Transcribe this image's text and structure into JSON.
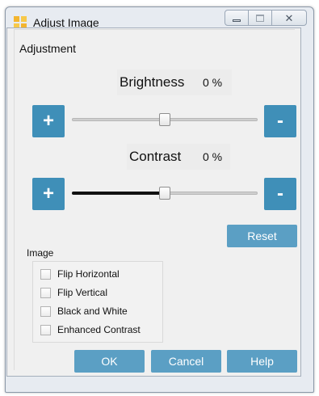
{
  "window": {
    "title": "Adjust Image",
    "close_glyph": "✕"
  },
  "adjustment": {
    "section_title": "Adjustment",
    "brightness": {
      "label": "Brightness",
      "value_text": "0 %",
      "level_fraction": 0.5
    },
    "contrast": {
      "label": "Contrast",
      "value_text": "0 %",
      "level_fraction": 0.5
    },
    "increase_glyph": "+",
    "decrease_glyph": "-",
    "reset_label": "Reset"
  },
  "image_options": {
    "group_label": "Image",
    "items": [
      {
        "label": "Flip Horizontal",
        "checked": false
      },
      {
        "label": "Flip Vertical",
        "checked": false
      },
      {
        "label": "Black and White",
        "checked": false
      },
      {
        "label": "Enhanced Contrast",
        "checked": false
      }
    ]
  },
  "footer": {
    "ok_label": "OK",
    "cancel_label": "Cancel",
    "help_label": "Help"
  },
  "colors": {
    "accent": "#3f8fb8",
    "button": "#5b9fc4",
    "frame": "#e7ebf1"
  },
  "icons": {
    "app": "app-grid-icon",
    "minimize": "minimize-icon",
    "maximize": "maximize-icon",
    "close": "close-icon"
  }
}
